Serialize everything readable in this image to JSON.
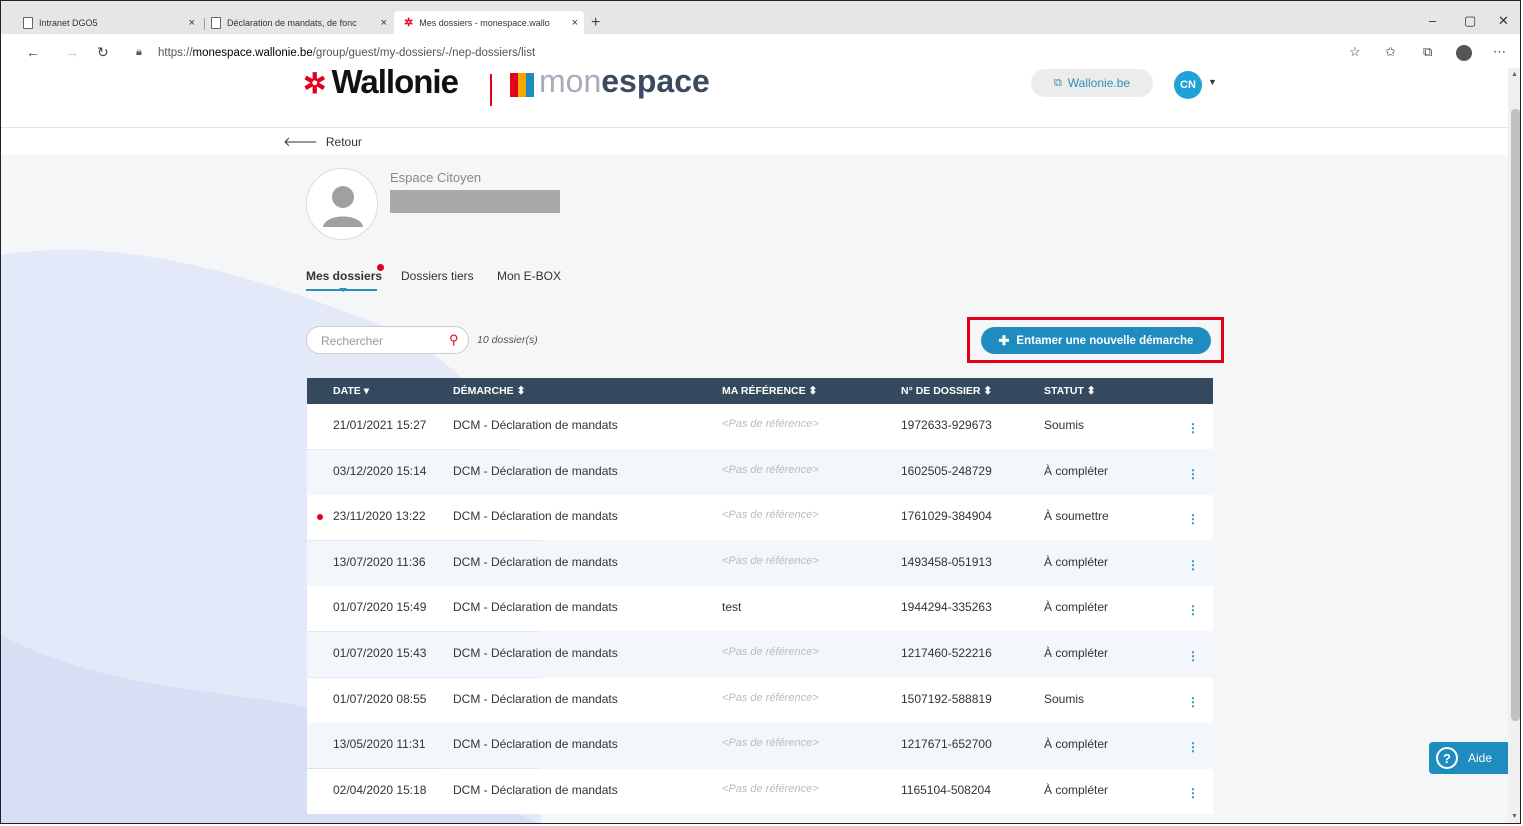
{
  "browser": {
    "tabs": [
      {
        "title": "Intranet DGO5"
      },
      {
        "title": "Déclaration de mandats, de fonc"
      },
      {
        "title": "Mes dossiers - monespace.wallo"
      }
    ],
    "close_glyph": "×",
    "new_tab_glyph": "+",
    "url_prefix": "https://",
    "url_host": "monespace.wallonie.be",
    "url_path": "/group/guest/my-dossiers/-/nep-dossiers/list"
  },
  "header": {
    "logo_text": "Wallonie",
    "logo_app_light": "mon",
    "logo_app_bold": "espace",
    "wallonie_link": "Wallonie.be",
    "user_initials": "CN"
  },
  "retour_label": "Retour",
  "profile": {
    "title": "Espace Citoyen"
  },
  "tabs": {
    "mes_dossiers": "Mes dossiers",
    "dossiers_tiers": "Dossiers tiers",
    "ebox": "Mon E-BOX"
  },
  "search": {
    "placeholder": "Rechercher",
    "count_label": "10 dossier(s)"
  },
  "new_demarche_label": "Entamer une nouvelle démarche",
  "table": {
    "columns": {
      "date": "DATE ▾",
      "demarche": "DÉMARCHE ⬍",
      "reference": "MA RÉFÉRENCE ⬍",
      "dossier": "N° DE DOSSIER ⬍",
      "statut": "STATUT ⬍"
    },
    "rows": [
      {
        "date": "21/01/2021 15:27",
        "demarche": "DCM - Déclaration de mandats",
        "reference": "<Pas de référence>",
        "dossier": "1972633-929673",
        "statut": "Soumis",
        "ref_empty": true,
        "unread": false
      },
      {
        "date": "03/12/2020 15:14",
        "demarche": "DCM - Déclaration de mandats",
        "reference": "<Pas de référence>",
        "dossier": "1602505-248729",
        "statut": "À compléter",
        "ref_empty": true,
        "unread": false
      },
      {
        "date": "23/11/2020 13:22",
        "demarche": "DCM - Déclaration de mandats",
        "reference": "<Pas de référence>",
        "dossier": "1761029-384904",
        "statut": "À soumettre",
        "ref_empty": true,
        "unread": true
      },
      {
        "date": "13/07/2020 11:36",
        "demarche": "DCM - Déclaration de mandats",
        "reference": "<Pas de référence>",
        "dossier": "1493458-051913",
        "statut": "À compléter",
        "ref_empty": true,
        "unread": false
      },
      {
        "date": "01/07/2020 15:49",
        "demarche": "DCM - Déclaration de mandats",
        "reference": "test",
        "dossier": "1944294-335263",
        "statut": "À compléter",
        "ref_empty": false,
        "unread": false
      },
      {
        "date": "01/07/2020 15:43",
        "demarche": "DCM - Déclaration de mandats",
        "reference": "<Pas de référence>",
        "dossier": "1217460-522216",
        "statut": "À compléter",
        "ref_empty": true,
        "unread": false
      },
      {
        "date": "01/07/2020 08:55",
        "demarche": "DCM - Déclaration de mandats",
        "reference": "<Pas de référence>",
        "dossier": "1507192-588819",
        "statut": "Soumis",
        "ref_empty": true,
        "unread": false
      },
      {
        "date": "13/05/2020 11:31",
        "demarche": "DCM - Déclaration de mandats",
        "reference": "<Pas de référence>",
        "dossier": "1217671-652700",
        "statut": "À compléter",
        "ref_empty": true,
        "unread": false
      },
      {
        "date": "02/04/2020 15:18",
        "demarche": "DCM - Déclaration de mandats",
        "reference": "<Pas de référence>",
        "dossier": "1165104-508204",
        "statut": "À compléter",
        "ref_empty": true,
        "unread": false
      }
    ]
  },
  "help_label": "Aide",
  "colors": {
    "brand_red": "#e3001b",
    "accent_blue": "#1e8cbf",
    "table_header": "#34495e"
  }
}
